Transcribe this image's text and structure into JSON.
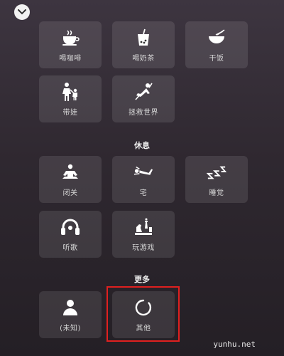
{
  "top_tiles": [
    {
      "label": "喝咖啡",
      "icon": "coffee-icon"
    },
    {
      "label": "喝奶茶",
      "icon": "milk-tea-icon"
    },
    {
      "label": "干饭",
      "icon": "rice-bowl-icon"
    },
    {
      "label": "带娃",
      "icon": "parent-child-icon"
    },
    {
      "label": "拯救世界",
      "icon": "superhero-icon"
    }
  ],
  "rest": {
    "title": "休息",
    "tiles": [
      {
        "label": "闭关",
        "icon": "meditation-icon"
      },
      {
        "label": "宅",
        "icon": "lying-person-icon"
      },
      {
        "label": "睡觉",
        "icon": "sleep-zzz-icon"
      },
      {
        "label": "听歌",
        "icon": "headphones-icon"
      },
      {
        "label": "玩游戏",
        "icon": "chess-game-icon"
      }
    ]
  },
  "more": {
    "title": "更多",
    "tiles": [
      {
        "label": "(未知)",
        "icon": "unknown-person-icon"
      },
      {
        "label": "其他",
        "icon": "circle-icon"
      }
    ]
  },
  "watermark": "yunhu.net",
  "colors": {
    "tile_bg": "rgba(255,255,255,0.10)",
    "highlight": "#e0201f"
  }
}
